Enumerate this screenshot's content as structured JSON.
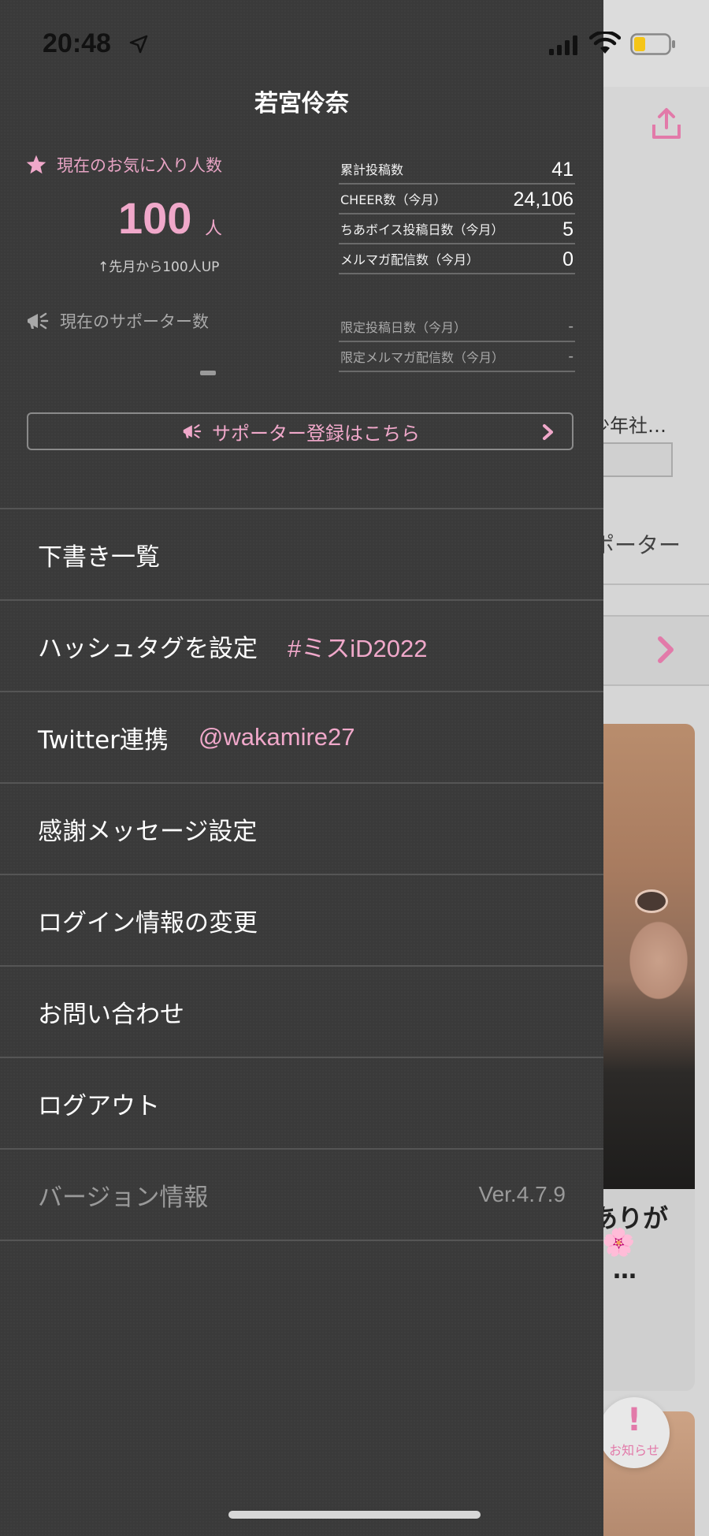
{
  "status_bar": {
    "time": "20:48"
  },
  "background_app": {
    "snippet_1": "少年社…",
    "snippet_2": "ポーター",
    "card_text": "ありが",
    "card_emoji": "🌸",
    "card_ellipsis": "…",
    "notice_mark": "!",
    "notice_label": "お知らせ"
  },
  "drawer": {
    "profile_name": "若宮伶奈",
    "favorites": {
      "label": "現在のお気に入り人数",
      "count": "100",
      "unit": "人",
      "change": "↑先月から100人UP"
    },
    "supporters": {
      "label": "現在のサポーター数",
      "count": "-"
    },
    "stats": [
      {
        "label": "累計投稿数",
        "value": "41"
      },
      {
        "label": "CHEER数（今月）",
        "value": "24,106"
      },
      {
        "label": "ちあボイス投稿日数（今月）",
        "value": "5"
      },
      {
        "label": "メルマガ配信数（今月）",
        "value": "0"
      }
    ],
    "limited_stats": [
      {
        "label": "限定投稿日数（今月）",
        "value": "-"
      },
      {
        "label": "限定メルマガ配信数（今月）",
        "value": "-"
      }
    ],
    "supporter_button": {
      "label": "サポーター登録はこちら"
    },
    "menu": {
      "drafts": {
        "label": "下書き一覧"
      },
      "hashtag": {
        "label": "ハッシュタグを設定",
        "value": "#ミスiD2022"
      },
      "twitter": {
        "label": "Twitter連携",
        "value": "@wakamire27"
      },
      "thanks": {
        "label": "感謝メッセージ設定"
      },
      "login": {
        "label": "ログイン情報の変更"
      },
      "contact": {
        "label": "お問い合わせ"
      },
      "logout": {
        "label": "ログアウト"
      },
      "version": {
        "label": "バージョン情報",
        "value": "Ver.4.7.9"
      }
    }
  },
  "colors": {
    "accent_pink": "#f0a8ca",
    "drawer_bg": "#3a3a3a",
    "divider": "#555555"
  }
}
